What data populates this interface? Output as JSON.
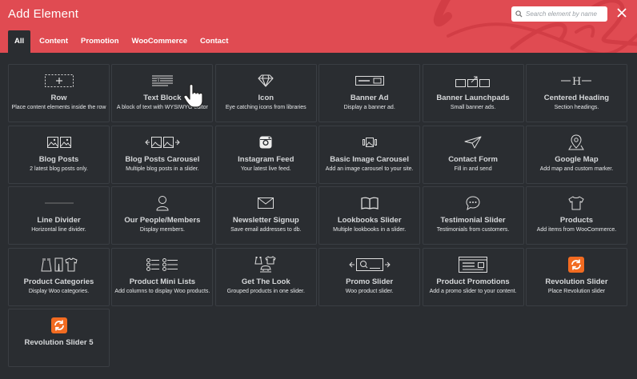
{
  "header": {
    "title": "Add Element",
    "search_placeholder": "Search element by name",
    "colors": {
      "header_bg": "#e04b52",
      "panel_bg": "#2a2d31",
      "cell_border": "#3a3e43",
      "accent_orange": "#f26b21"
    }
  },
  "tabs": [
    {
      "label": "All",
      "active": true
    },
    {
      "label": "Content"
    },
    {
      "label": "Promotion"
    },
    {
      "label": "WooCommerce"
    },
    {
      "label": "Contact"
    }
  ],
  "elements": [
    {
      "icon": "plus-box-icon",
      "name": "Row",
      "desc": "Place content elements inside the row"
    },
    {
      "icon": "text-block-icon",
      "name": "Text Block",
      "desc": "A block of text with WYSIWYG editor"
    },
    {
      "icon": "diamond-icon",
      "name": "Icon",
      "desc": "Eye catching icons from libraries"
    },
    {
      "icon": "banner-ad-icon",
      "name": "Banner Ad",
      "desc": "Display a banner ad."
    },
    {
      "icon": "banner-launchpads-icon",
      "name": "Banner Launchpads",
      "desc": "Small banner ads."
    },
    {
      "icon": "heading-icon",
      "name": "Centered Heading",
      "desc": "Section headings."
    },
    {
      "icon": "blog-posts-icon",
      "name": "Blog Posts",
      "desc": "2 latest blog posts only."
    },
    {
      "icon": "blog-carousel-icon",
      "name": "Blog Posts Carousel",
      "desc": "Multiple blog posts in a slider."
    },
    {
      "icon": "instagram-icon",
      "name": "Instagram Feed",
      "desc": "Your latest live feed."
    },
    {
      "icon": "image-carousel-icon",
      "name": "Basic Image Carousel",
      "desc": "Add an image carousel to your site."
    },
    {
      "icon": "paper-plane-icon",
      "name": "Contact Form",
      "desc": "Fill in and send"
    },
    {
      "icon": "map-pin-icon",
      "name": "Google Map",
      "desc": "Add map and custom marker."
    },
    {
      "icon": "line-divider-icon",
      "name": "Line Divider",
      "desc": "Horizontal line divider."
    },
    {
      "icon": "person-icon",
      "name": "Our People/Members",
      "desc": "Display members."
    },
    {
      "icon": "envelope-icon",
      "name": "Newsletter Signup",
      "desc": "Save email addresses to db."
    },
    {
      "icon": "book-icon",
      "name": "Lookbooks Slider",
      "desc": "Multiple lookbooks in a slider."
    },
    {
      "icon": "chat-bubble-icon",
      "name": "Testimonial Slider",
      "desc": "Testimonials from customers."
    },
    {
      "icon": "shirt-icon",
      "name": "Products",
      "desc": "Add items from WooCommerce."
    },
    {
      "icon": "clothes-icon",
      "name": "Product Categories",
      "desc": "Display Woo categories."
    },
    {
      "icon": "list-icon",
      "name": "Product Mini Lists",
      "desc": "Add columns to display Woo products."
    },
    {
      "icon": "outfit-icon",
      "name": "Get The Look",
      "desc": "Grouped products in one slider."
    },
    {
      "icon": "promo-slider-icon",
      "name": "Promo Slider",
      "desc": "Woo product slider."
    },
    {
      "icon": "promotions-icon",
      "name": "Product Promotions",
      "desc": "Add a promo slider to your content."
    },
    {
      "icon": "revolution-icon",
      "name": "Revolution Slider",
      "desc": "Place Revolution slider"
    },
    {
      "icon": "revolution-icon",
      "name": "Revolution Slider 5",
      "desc": ""
    }
  ]
}
